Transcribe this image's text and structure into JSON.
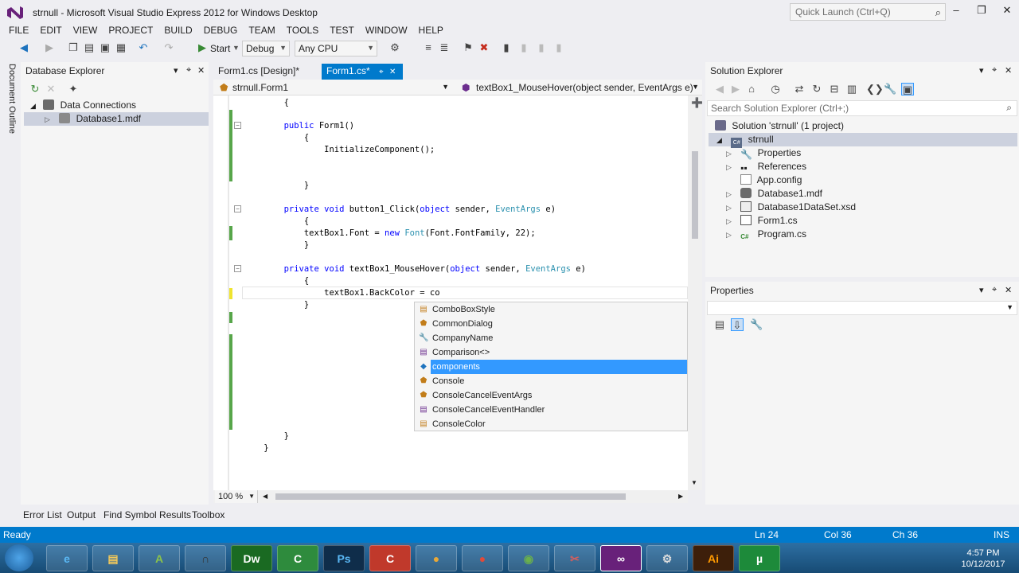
{
  "window": {
    "title": "strnull - Microsoft Visual Studio Express 2012 for Windows Desktop",
    "quick_launch_placeholder": "Quick Launch (Ctrl+Q)"
  },
  "menu": [
    "FILE",
    "EDIT",
    "VIEW",
    "PROJECT",
    "BUILD",
    "DEBUG",
    "TEAM",
    "TOOLS",
    "TEST",
    "WINDOW",
    "HELP"
  ],
  "toolbar": {
    "start_label": "Start",
    "config": "Debug",
    "platform": "Any CPU"
  },
  "left_strip": {
    "document_outline": "Document Outline"
  },
  "database_explorer": {
    "title": "Database Explorer",
    "tree": [
      {
        "label": "Data Connections"
      },
      {
        "label": "Database1.mdf"
      }
    ]
  },
  "editor": {
    "tabs": [
      {
        "label": "Form1.cs [Design]*"
      },
      {
        "label": "Form1.cs*"
      }
    ],
    "nav_class": "strnull.Form1",
    "nav_member": "textBox1_MouseHover(object sender, EventArgs e)",
    "zoom": "100 %",
    "code": [
      "        {",
      "            public Form1()",
      "            {",
      "                InitializeComponent();",
      "            }",
      "            private void button1_Click(object sender, EventArgs e)",
      "            {",
      "                textBox1.Font = new Font(Font.FontFamily, 22);",
      "            }",
      "            private void textBox1_MouseHover(object sender, EventArgs e)",
      "            {",
      "                textBox1.BackColor = co",
      "            }",
      "        }",
      "    }"
    ]
  },
  "intellisense": {
    "items": [
      {
        "label": "ComboBoxStyle",
        "icon": "enum-icon"
      },
      {
        "label": "CommonDialog",
        "icon": "class-icon"
      },
      {
        "label": "CompanyName",
        "icon": "property-icon"
      },
      {
        "label": "Comparison<>",
        "icon": "delegate-icon"
      },
      {
        "label": "components",
        "icon": "field-icon",
        "selected": true
      },
      {
        "label": "Console",
        "icon": "class-icon"
      },
      {
        "label": "ConsoleCancelEventArgs",
        "icon": "class-icon"
      },
      {
        "label": "ConsoleCancelEventHandler",
        "icon": "delegate-icon"
      },
      {
        "label": "ConsoleColor",
        "icon": "enum-icon"
      }
    ]
  },
  "solution_explorer": {
    "title": "Solution Explorer",
    "search_placeholder": "Search Solution Explorer (Ctrl+;)",
    "tree": [
      {
        "label": "Solution 'strnull' (1 project)"
      },
      {
        "label": "strnull"
      },
      {
        "label": "Properties"
      },
      {
        "label": "References"
      },
      {
        "label": "App.config"
      },
      {
        "label": "Database1.mdf"
      },
      {
        "label": "Database1DataSet.xsd"
      },
      {
        "label": "Form1.cs"
      },
      {
        "label": "Program.cs"
      }
    ]
  },
  "properties": {
    "title": "Properties"
  },
  "bottom_tabs": [
    "Error List",
    "Output",
    "Find Symbol Results",
    "Toolbox"
  ],
  "status": {
    "state": "Ready",
    "line": "Ln 24",
    "col": "Col 36",
    "ch": "Ch 36",
    "mode": "INS"
  },
  "taskbar": {
    "time": "4:57 PM",
    "date": "10/12/2017",
    "apps": [
      "start-orb",
      "internet-explorer",
      "file-explorer",
      "android-studio",
      "headphones-app",
      "dreamweaver",
      "camtasia-green",
      "photoshop",
      "camtasia-red",
      "chrome-canary",
      "chrome",
      "network-app",
      "snipping-tool",
      "visual-studio",
      "settings-app",
      "illustrator",
      "utorrent"
    ]
  },
  "colors": {
    "accent": "#007acc",
    "selection": "#3399ff",
    "keyword": "#0000ff",
    "type": "#2b91af",
    "active_tab": "#007acc"
  }
}
